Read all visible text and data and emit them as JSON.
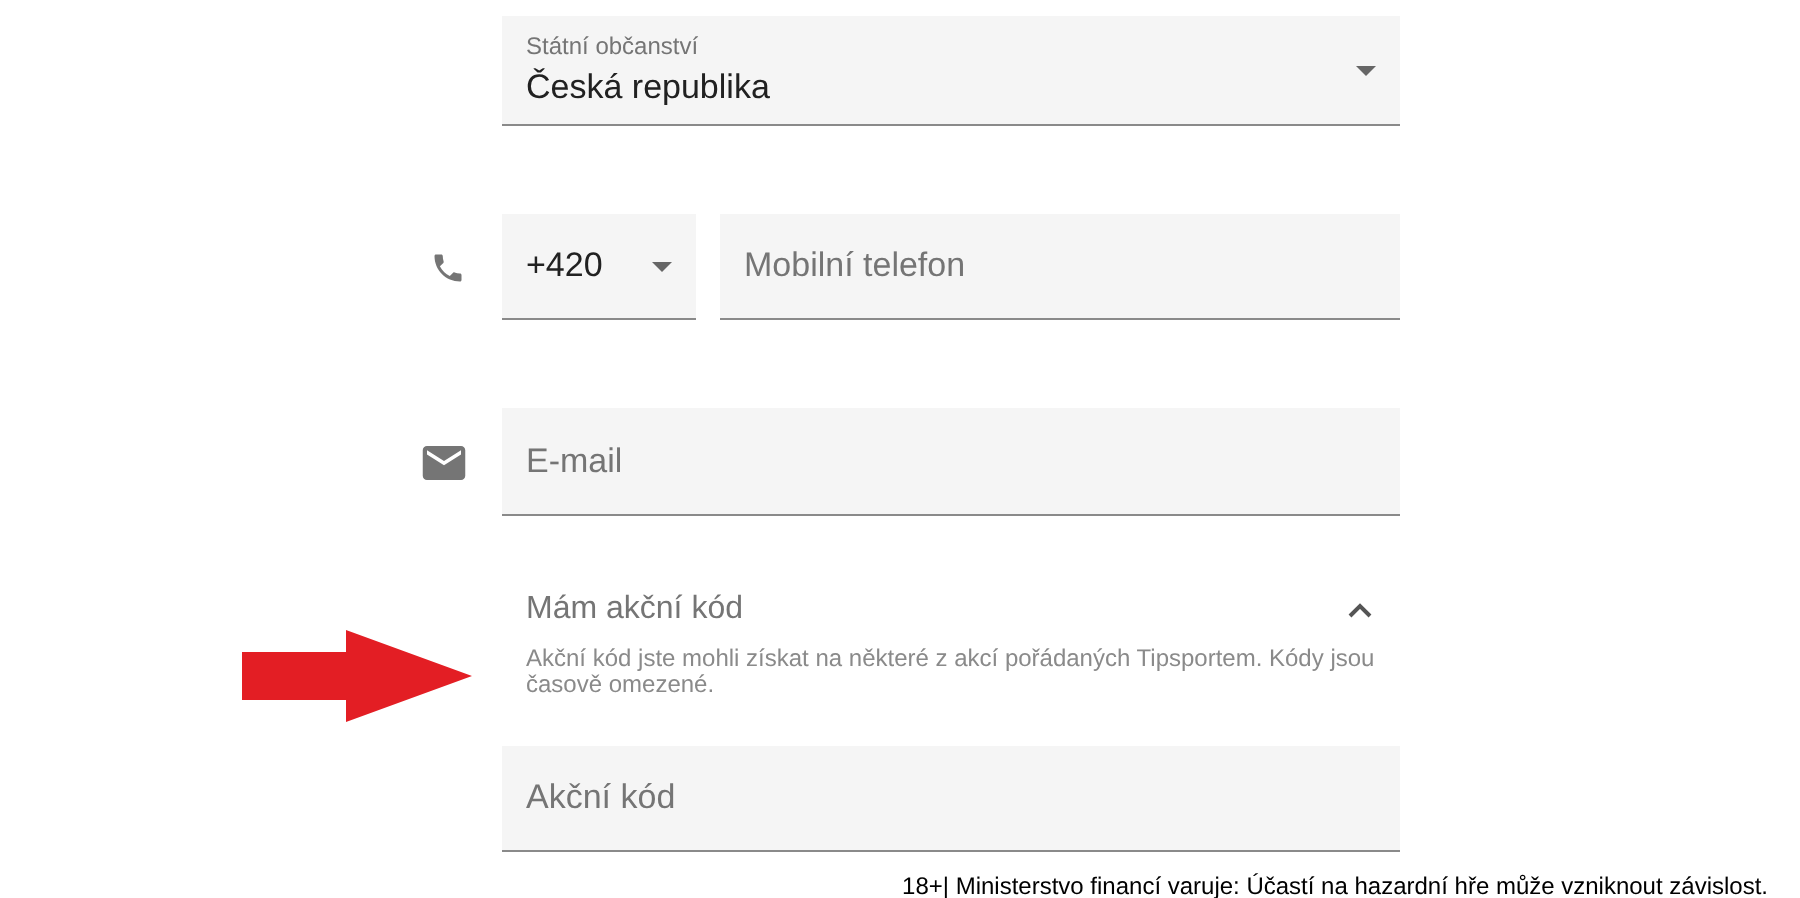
{
  "citizenship": {
    "label": "Státní občanství",
    "value": "Česká republika",
    "kind": "select"
  },
  "phone": {
    "prefix": {
      "value": "+420",
      "kind": "select"
    },
    "number": {
      "placeholder": "Mobilní telefon"
    }
  },
  "email": {
    "placeholder": "E-mail"
  },
  "promo": {
    "title": "Mám akční kód",
    "expanded": true,
    "help": "Akční kód jste mohli získat na některé z akcí pořádaných Tipsportem. Kódy jsou časově omezené.",
    "field": {
      "placeholder": "Akční kód"
    }
  },
  "disclaimer": "18+| Ministerstvo financí varuje: Účastí na hazardní hře může vzniknout závislost."
}
